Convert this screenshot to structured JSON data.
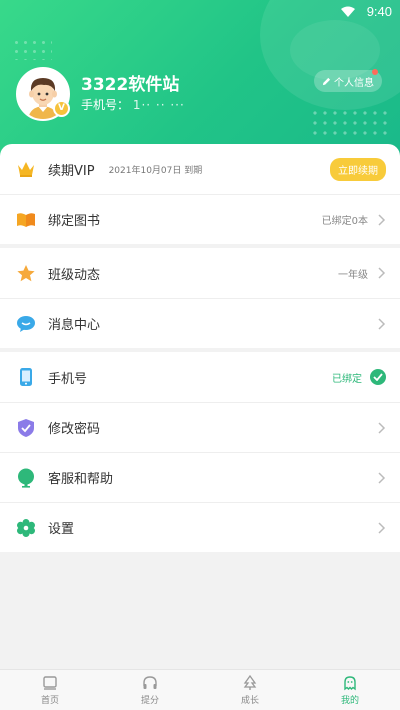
{
  "status_bar": {
    "time": "9:40"
  },
  "profile": {
    "name": "3322软件站",
    "phone_label": "手机号：",
    "phone_value": "1·· ·· ···",
    "vip_badge": "V",
    "info_button": "个人信息"
  },
  "menu": {
    "vip": {
      "label": "续期VIP",
      "date": "2021年10月07日 到期",
      "action": "立即续期"
    },
    "books": {
      "label": "绑定图书",
      "right": "已绑定0本"
    },
    "class": {
      "label": "班级动态",
      "right": "一年级"
    },
    "messages": {
      "label": "消息中心"
    },
    "phone": {
      "label": "手机号",
      "right": "已绑定"
    },
    "password": {
      "label": "修改密码"
    },
    "support": {
      "label": "客服和帮助"
    },
    "settings": {
      "label": "设置"
    }
  },
  "tabbar": {
    "items": [
      "首页",
      "提分",
      "成长",
      "我的"
    ],
    "active_color": "#2eb87a"
  },
  "colors": {
    "header": "#21c487",
    "accent": "#2eb87a",
    "vip": "#f8cb3a"
  }
}
